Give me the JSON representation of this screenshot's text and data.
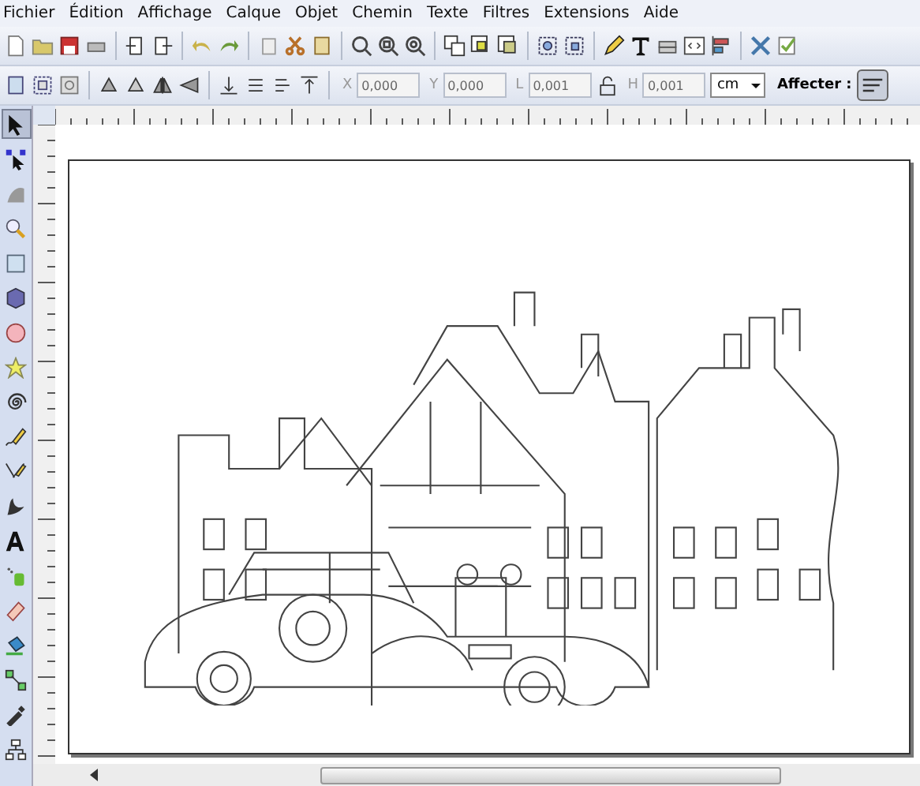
{
  "menu": [
    "Fichier",
    "Édition",
    "Affichage",
    "Calque",
    "Objet",
    "Chemin",
    "Texte",
    "Filtres",
    "Extensions",
    "Aide"
  ],
  "fields": [
    {
      "label": "X",
      "value": "0,000"
    },
    {
      "label": "Y",
      "value": "0,000"
    },
    {
      "label": "L",
      "value": "0,001"
    },
    {
      "label": "H",
      "value": "0,001"
    }
  ],
  "unit": "cm",
  "affect_label": "Affecter :",
  "tools": [
    {
      "kind": "select",
      "selected": true
    },
    {
      "kind": "node",
      "selected": false
    },
    {
      "kind": "tweak",
      "selected": false
    },
    {
      "kind": "zoom",
      "selected": false
    },
    {
      "kind": "rect",
      "selected": false
    },
    {
      "kind": "box3d",
      "selected": false
    },
    {
      "kind": "ellipse",
      "selected": false
    },
    {
      "kind": "star",
      "selected": false
    },
    {
      "kind": "spiral",
      "selected": false
    },
    {
      "kind": "pencil",
      "selected": false
    },
    {
      "kind": "pen",
      "selected": false
    },
    {
      "kind": "calligraphy",
      "selected": false
    },
    {
      "kind": "text",
      "selected": false
    },
    {
      "kind": "spray",
      "selected": false
    },
    {
      "kind": "eraser",
      "selected": false
    },
    {
      "kind": "bucket",
      "selected": false
    },
    {
      "kind": "connector",
      "selected": false
    },
    {
      "kind": "dropper",
      "selected": false
    },
    {
      "kind": "tree",
      "selected": false
    }
  ]
}
